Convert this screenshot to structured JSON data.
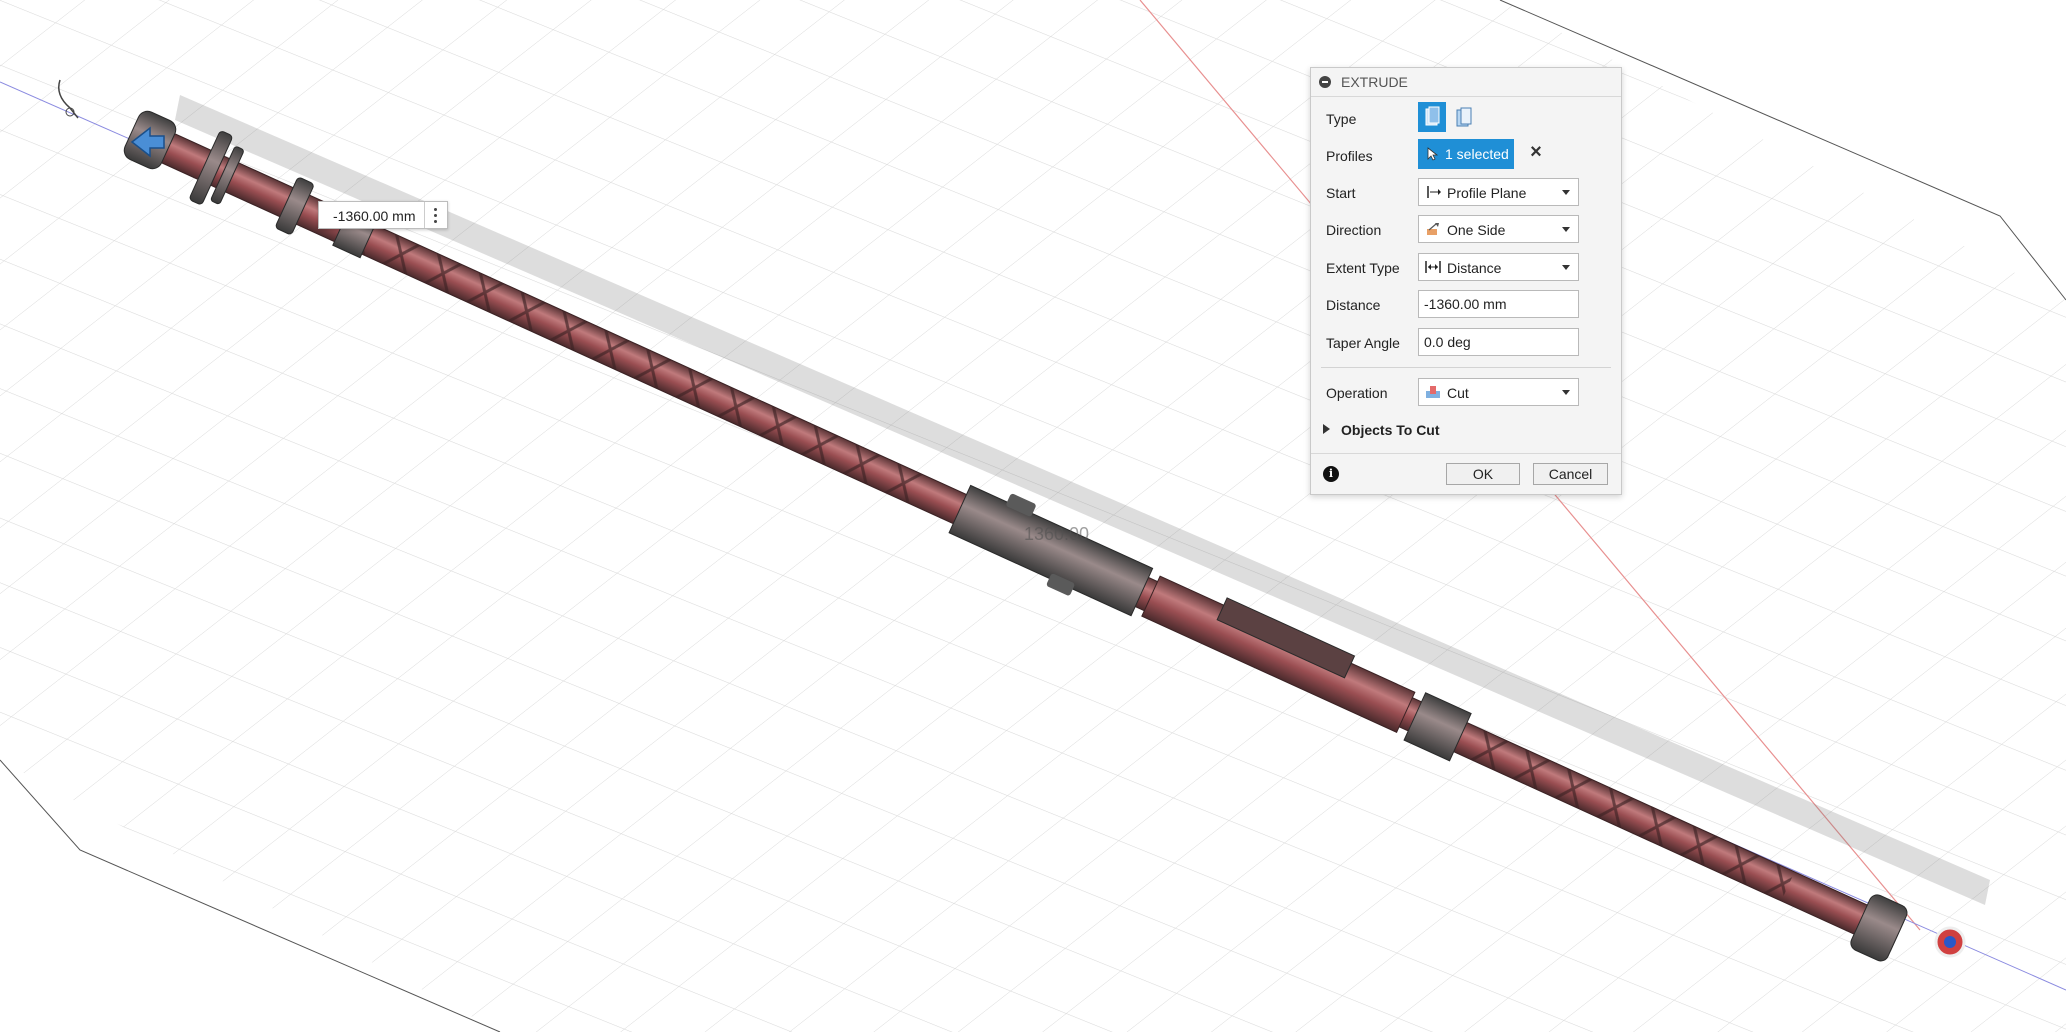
{
  "viewport": {
    "dimension_input_value": "-1360.00 mm",
    "dimension_label": "1360.00"
  },
  "panel": {
    "title": "EXTRUDE",
    "type_label": "Type",
    "profiles_label": "Profiles",
    "profiles_value": "1 selected",
    "start_label": "Start",
    "start_value": "Profile Plane",
    "direction_label": "Direction",
    "direction_value": "One Side",
    "extent_type_label": "Extent Type",
    "extent_type_value": "Distance",
    "distance_label": "Distance",
    "distance_value": "-1360.00 mm",
    "taper_angle_label": "Taper Angle",
    "taper_angle_value": "0.0 deg",
    "operation_label": "Operation",
    "operation_value": "Cut",
    "objects_to_cut_label": "Objects To Cut",
    "ok_label": "OK",
    "cancel_label": "Cancel"
  },
  "colors": {
    "accent": "#1f8fd6",
    "body_red": "#a8565a",
    "metal": "#6e6e6e"
  }
}
